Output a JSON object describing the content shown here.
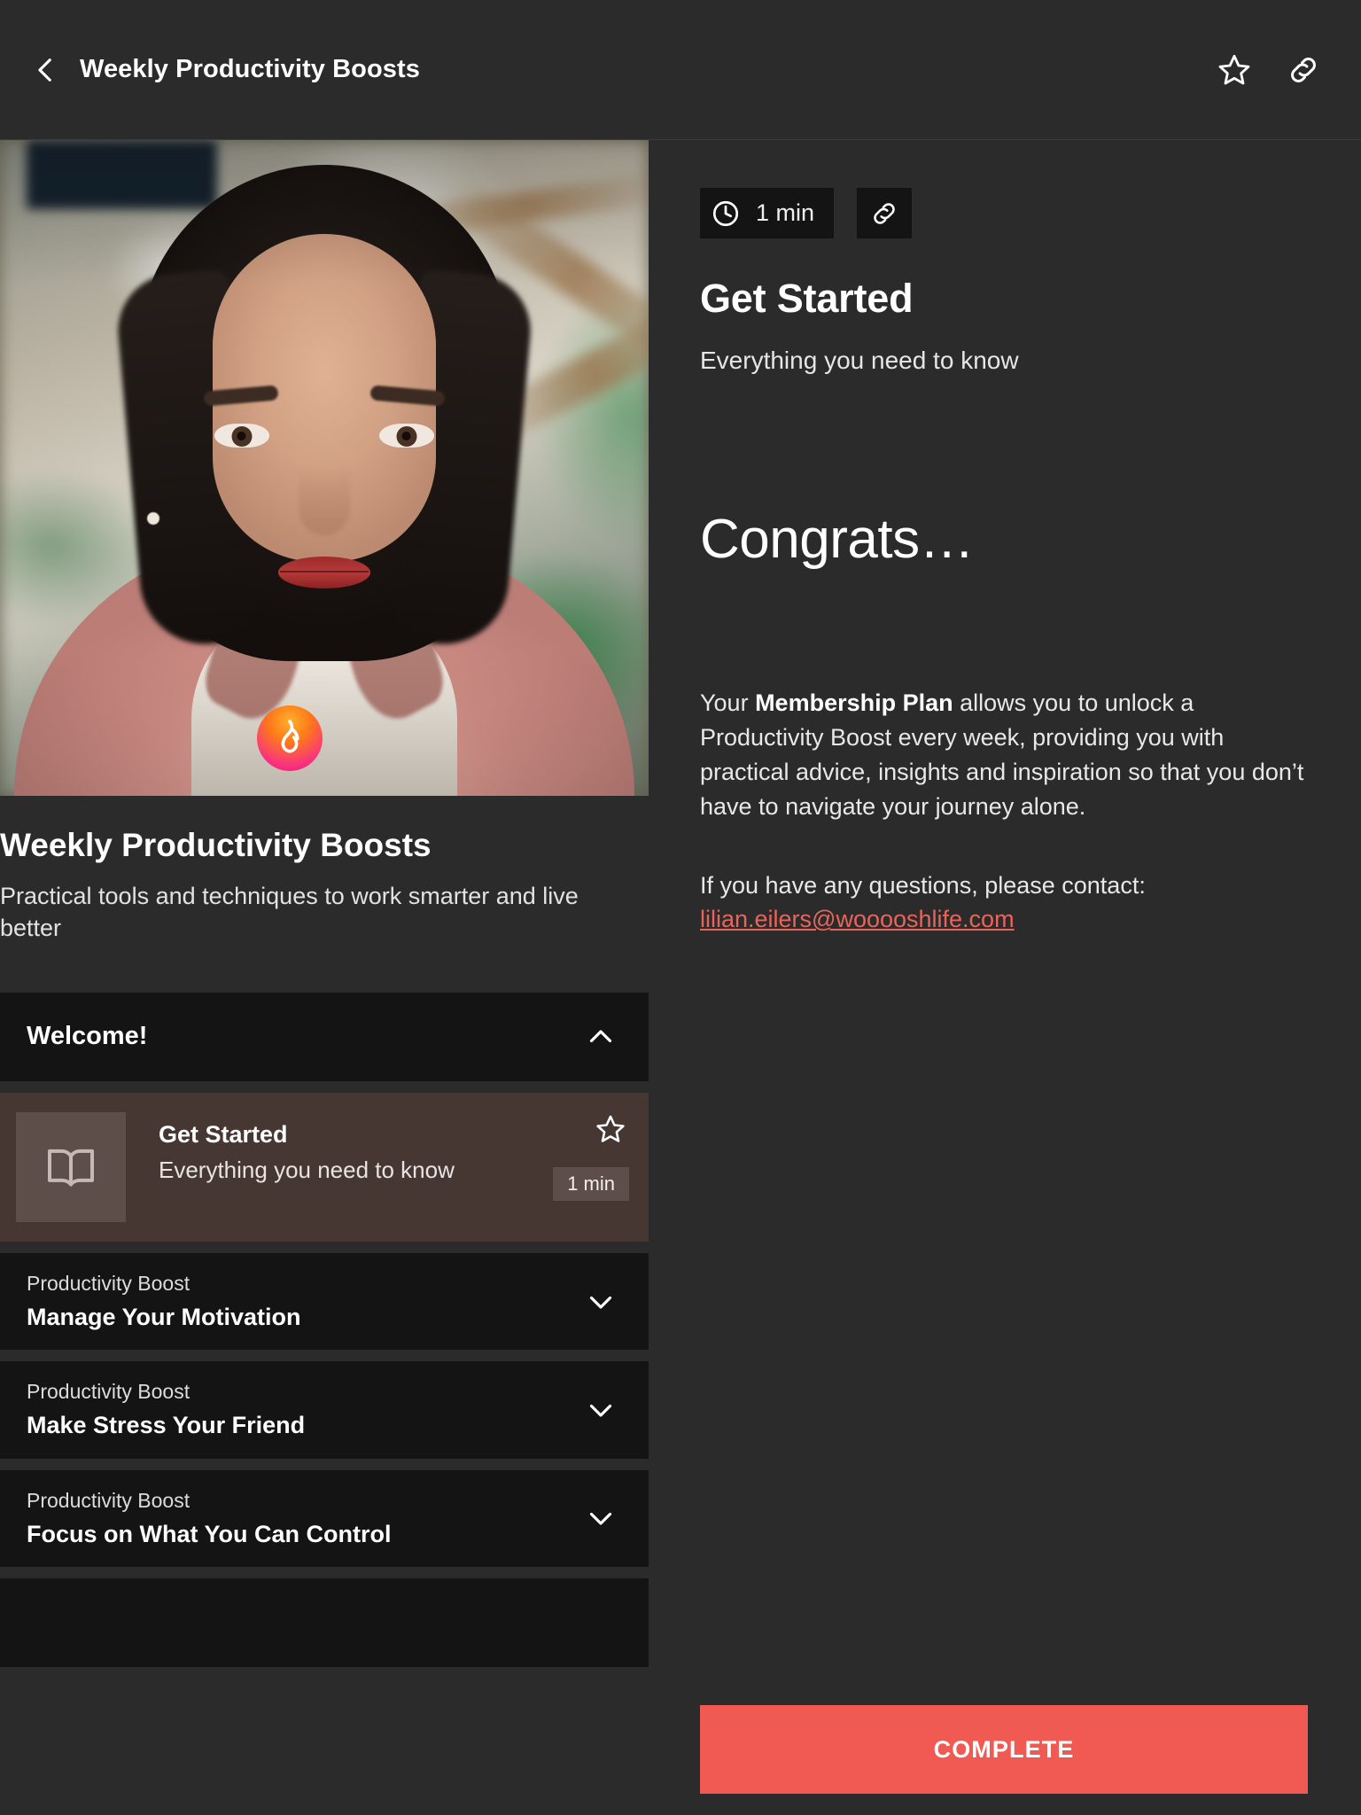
{
  "topbar": {
    "back_icon": "chevron-left-icon",
    "title": "Weekly Productivity Boosts",
    "favorite_icon": "star-outline-icon",
    "share_icon": "link-icon"
  },
  "course": {
    "title": "Weekly Productivity Boosts",
    "subtitle": "Practical tools and techniques to work smarter and live better",
    "hero_badge_icon": "flame-logo-icon"
  },
  "accordion": {
    "sections": [
      {
        "eyebrow": "",
        "title": "Welcome!",
        "expanded": true,
        "chevron_icon": "chevron-up-icon",
        "lessons": [
          {
            "title": "Get Started",
            "subtitle": "Everything you need to know",
            "duration": "1 min",
            "thumb_icon": "open-book-icon",
            "star_icon": "star-outline-icon",
            "active": true
          }
        ]
      },
      {
        "eyebrow": "Productivity Boost",
        "title": "Manage Your Motivation",
        "expanded": false,
        "chevron_icon": "chevron-down-icon",
        "lessons": []
      },
      {
        "eyebrow": "Productivity Boost",
        "title": "Make Stress Your Friend",
        "expanded": false,
        "chevron_icon": "chevron-down-icon",
        "lessons": []
      },
      {
        "eyebrow": "Productivity Boost",
        "title": "Focus on What You Can Control",
        "expanded": false,
        "chevron_icon": "chevron-down-icon",
        "lessons": []
      }
    ]
  },
  "detail": {
    "duration": "1 min",
    "clock_icon": "clock-icon",
    "share_icon": "link-icon",
    "heading": "Get Started",
    "description": "Everything you need to know",
    "congrats_heading": "Congrats…",
    "paragraph_part1": "Your ",
    "paragraph_bold": "Membership Plan",
    "paragraph_part2": " allows you to unlock a Productivity Boost every week, providing you with practical advice, insights and inspiration so that you don’t have to navigate your journey alone.",
    "contact_intro": "If you have any questions, please contact:",
    "contact_email": "lilian.eilers@wooooshlife.com",
    "complete_label": "COMPLETE"
  },
  "colors": {
    "page_background": "#2b2b2b",
    "card_background": "#141414",
    "active_lesson_background": "#473733",
    "accent_red": "#f05a52",
    "link_red": "#e8655c",
    "text_primary": "#ffffff",
    "text_secondary": "#e2e2e2"
  }
}
